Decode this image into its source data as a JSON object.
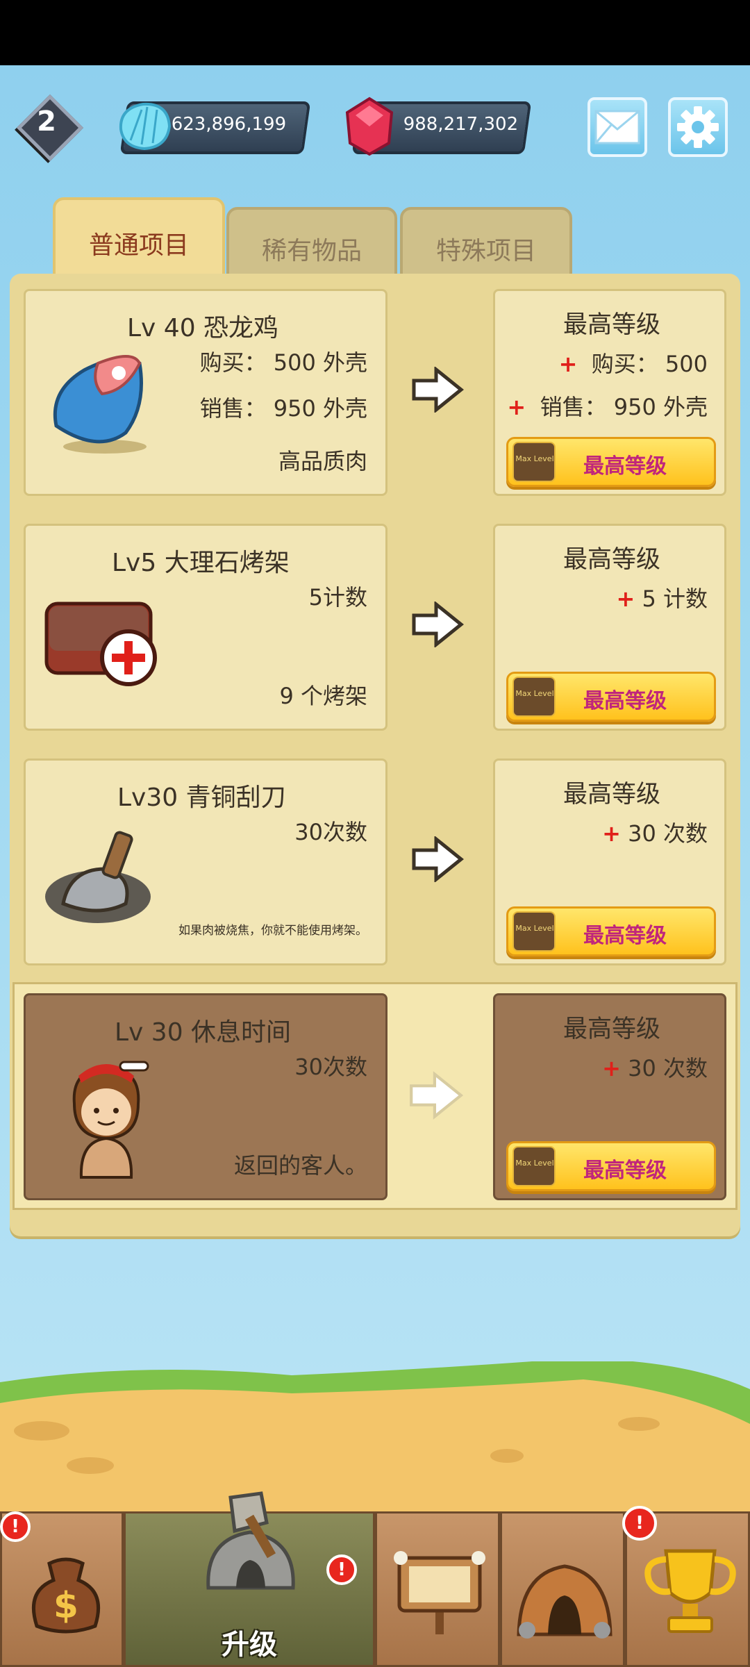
{
  "hud": {
    "level": "2",
    "shells": "623,896,199",
    "gems": "988,217,302",
    "mail_icon": "envelope-icon",
    "settings_icon": "gear-icon"
  },
  "tabs": [
    {
      "label": "普通项目",
      "active": true
    },
    {
      "label": "稀有物品",
      "active": false
    },
    {
      "label": "特殊项目",
      "active": false
    }
  ],
  "rows": [
    {
      "title": "Lv 40 恐龙鸡",
      "line1": "购买： 500 外壳",
      "line2": "销售： 950 外壳",
      "note": "高品质肉",
      "icon": "meat-icon",
      "next_title": "最高等级",
      "next_line1": "购买： 500",
      "next_line2": "销售： 950 外壳",
      "button": "最高等级",
      "badge": "Max Level"
    },
    {
      "title": "Lv5 大理石烤架",
      "line1": "5计数",
      "note": "9 个烤架",
      "icon": "grill-add-icon",
      "next_title": "最高等级",
      "next_line1": "5 计数",
      "button": "最高等级",
      "badge": "Max Level"
    },
    {
      "title": "Lv30 青铜刮刀",
      "line1": "30次数",
      "note": "如果肉被烧焦，你就不能使用烤架。",
      "icon": "scraper-icon",
      "next_title": "最高等级",
      "next_line1": "30 次数",
      "button": "最高等级",
      "badge": "Max Level"
    },
    {
      "title": "Lv 30 休息时间",
      "line1": "30次数",
      "note": "返回的客人。",
      "icon": "cave-girl-icon",
      "next_title": "最高等级",
      "next_line1": "30 次数",
      "button": "最高等级",
      "badge": "Max Level"
    }
  ],
  "nav": [
    {
      "icon": "money-bag-icon",
      "label": ""
    },
    {
      "icon": "stone-hut-icon",
      "label": "升级"
    },
    {
      "icon": "signboard-icon",
      "label": ""
    },
    {
      "icon": "cave-icon",
      "label": ""
    },
    {
      "icon": "trophy-icon",
      "label": ""
    }
  ],
  "alert_mark": "!",
  "colors": {
    "accent_red": "#e0201a",
    "button_yellow": "#ffc21d",
    "button_text": "#c0257c",
    "panel": "#e8d796"
  }
}
